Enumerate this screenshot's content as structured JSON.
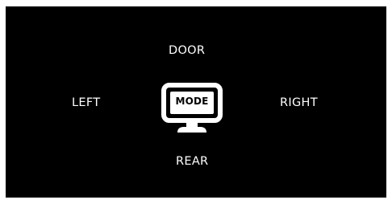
{
  "selector": {
    "up": "DOOR",
    "left": "LEFT",
    "center": "MODE",
    "right": "RIGHT",
    "down": "REAR",
    "center_icon": "monitor-icon"
  },
  "colors": {
    "background": "#000000",
    "foreground": "#ffffff"
  }
}
